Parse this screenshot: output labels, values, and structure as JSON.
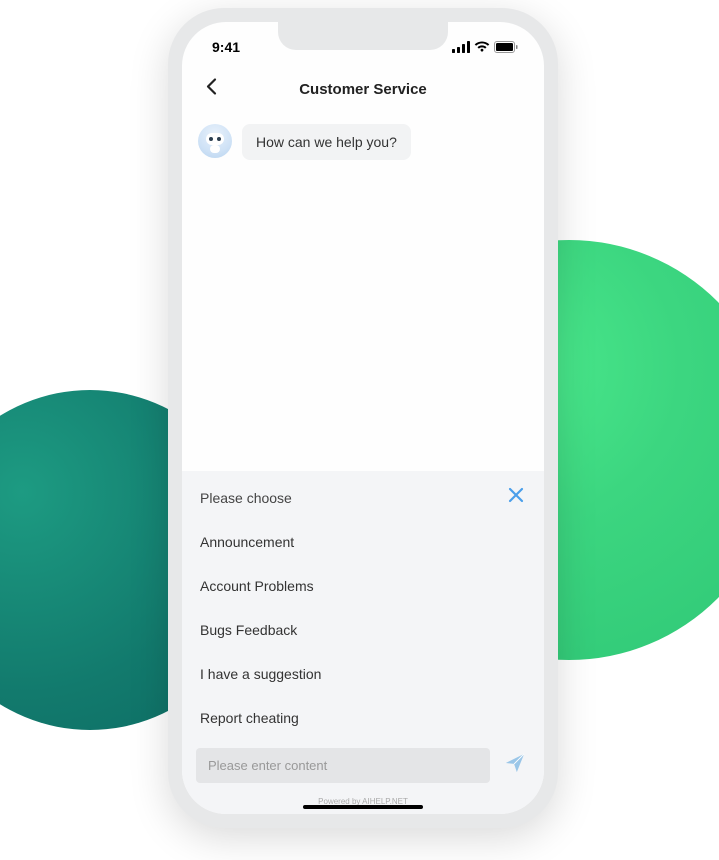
{
  "status_bar": {
    "time": "9:41"
  },
  "header": {
    "title": "Customer Service"
  },
  "chat": {
    "bot_message": "How can we help you?"
  },
  "panel": {
    "prompt": "Please choose",
    "options": [
      "Announcement",
      "Account Problems",
      "Bugs Feedback",
      "I have a suggestion",
      "Report cheating"
    ]
  },
  "input": {
    "placeholder": "Please enter content"
  },
  "footer": {
    "powered_by": "Powered by AIHELP.NET"
  }
}
